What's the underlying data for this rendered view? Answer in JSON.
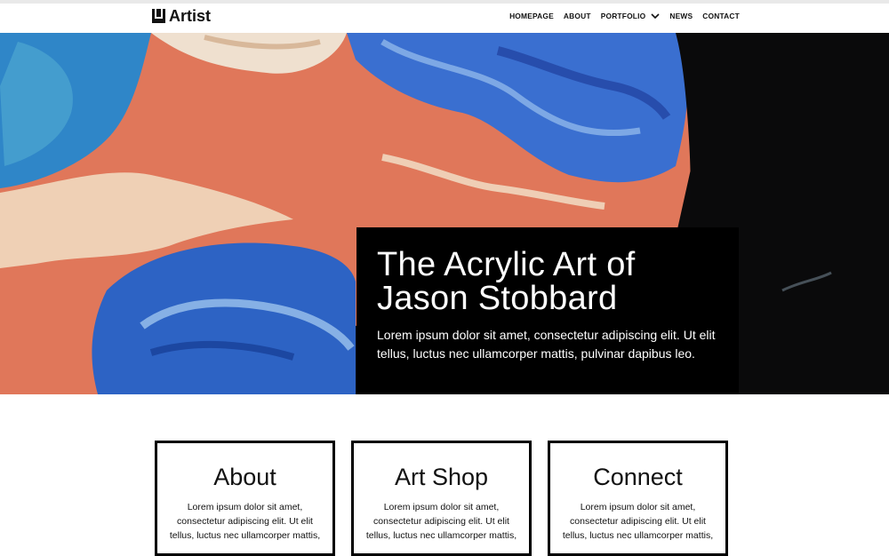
{
  "header": {
    "logo_text": "Artist",
    "nav": [
      {
        "label": "HOMEPAGE"
      },
      {
        "label": "ABOUT"
      },
      {
        "label": "PORTFOLIO",
        "has_dropdown": true
      },
      {
        "label": "NEWS"
      },
      {
        "label": "CONTACT"
      }
    ]
  },
  "hero": {
    "title": "The Acrylic Art of Jason Stobbard",
    "text": "Lorem ipsum dolor sit amet, consectetur adipiscing elit. Ut elit tellus, luctus nec ullamcorper mattis, pulvinar dapibus leo."
  },
  "cards": [
    {
      "title": "About",
      "text": "Lorem ipsum dolor sit amet, consectetur adipiscing elit. Ut elit tellus, luctus nec ullamcorper mattis,"
    },
    {
      "title": "Art Shop",
      "text": "Lorem ipsum dolor sit amet, consectetur adipiscing elit. Ut elit tellus, luctus nec ullamcorper mattis,"
    },
    {
      "title": "Connect",
      "text": "Lorem ipsum dolor sit amet, consectetur adipiscing elit. Ut elit tellus, luctus nec ullamcorper mattis,"
    }
  ],
  "colors": {
    "hero_coral": "#e0775a",
    "hero_blue": "#3b7fd0",
    "hero_dark": "#0b0b0c",
    "card_border": "#000000"
  }
}
